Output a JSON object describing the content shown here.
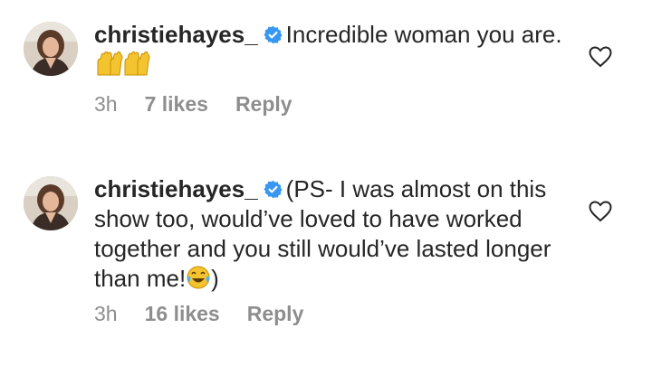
{
  "comments": [
    {
      "username": "christiehayes_",
      "text": "Incredible woman you are.",
      "emoji": "raising-hands",
      "closing": "",
      "time": "3h",
      "likes": "7 likes",
      "reply_label": "Reply"
    },
    {
      "username": "christiehayes_",
      "text": "(PS- I was almost on this show too, would’ve loved to have worked together and you still would’ve lasted longer than me!",
      "emoji": "tears-of-joy",
      "closing": ")",
      "time": "3h",
      "likes": "16 likes",
      "reply_label": "Reply"
    }
  ],
  "colors": {
    "text": "#262626",
    "muted": "#8e8e8e",
    "verified": "#3897f0",
    "heart_stroke": "#262626"
  },
  "icons": [
    "avatar",
    "verified-badge-icon",
    "raising-hands-emoji",
    "tears-of-joy-emoji",
    "heart-icon"
  ]
}
